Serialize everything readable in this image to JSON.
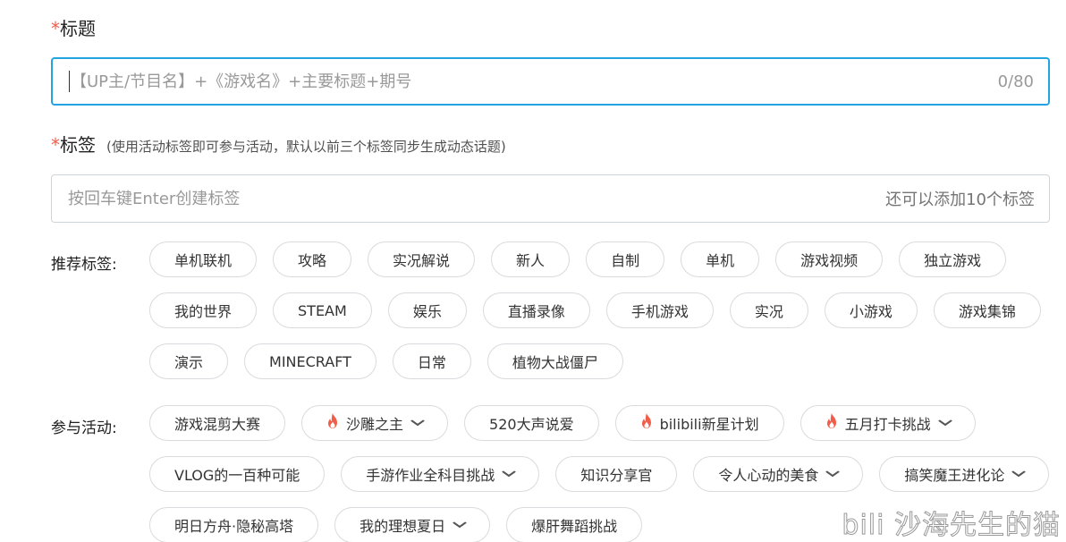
{
  "title_field": {
    "required_mark": "*",
    "label": "标题",
    "placeholder": "【UP主/节目名】+《游戏名》+主要标题+期号",
    "value": "",
    "counter": "0/80"
  },
  "tags_field": {
    "required_mark": "*",
    "label": "标签",
    "hint": "(使用活动标签即可参与活动，默认以前三个标签同步生成动态话题)",
    "placeholder": "按回车键Enter创建标签",
    "remaining": "还可以添加10个标签"
  },
  "recommended": {
    "label": "推荐标签:",
    "tags": [
      "单机联机",
      "攻略",
      "实况解说",
      "新人",
      "自制",
      "单机",
      "游戏视频",
      "独立游戏",
      "我的世界",
      "STEAM",
      "娱乐",
      "直播录像",
      "手机游戏",
      "实况",
      "小游戏",
      "游戏集锦",
      "演示",
      "MINECRAFT",
      "日常",
      "植物大战僵尸"
    ]
  },
  "activities": {
    "label": "参与活动:",
    "items": [
      {
        "label": "游戏混剪大赛",
        "hot": false,
        "dropdown": false
      },
      {
        "label": "沙雕之主",
        "hot": true,
        "dropdown": true
      },
      {
        "label": "520大声说爱",
        "hot": false,
        "dropdown": false
      },
      {
        "label": "bilibili新星计划",
        "hot": true,
        "dropdown": false
      },
      {
        "label": "五月打卡挑战",
        "hot": true,
        "dropdown": true
      },
      {
        "label": "VLOG的一百种可能",
        "hot": false,
        "dropdown": false
      },
      {
        "label": "手游作业全科目挑战",
        "hot": false,
        "dropdown": true
      },
      {
        "label": "知识分享官",
        "hot": false,
        "dropdown": false
      },
      {
        "label": "令人心动的美食",
        "hot": false,
        "dropdown": true
      },
      {
        "label": "搞笑魔王进化论",
        "hot": false,
        "dropdown": true
      },
      {
        "label": "明日方舟·隐秘高塔",
        "hot": false,
        "dropdown": false
      },
      {
        "label": "我的理想夏日",
        "hot": false,
        "dropdown": true
      },
      {
        "label": "爆肝舞蹈挑战",
        "hot": false,
        "dropdown": false
      }
    ]
  },
  "watermark": "bili 沙海先生的猫",
  "icons": {
    "hot": "fire-icon",
    "dropdown": "chevron-down-icon"
  },
  "colors": {
    "accent": "#22a4e0",
    "required": "#f25d4a",
    "hot": "#f25d4a"
  }
}
